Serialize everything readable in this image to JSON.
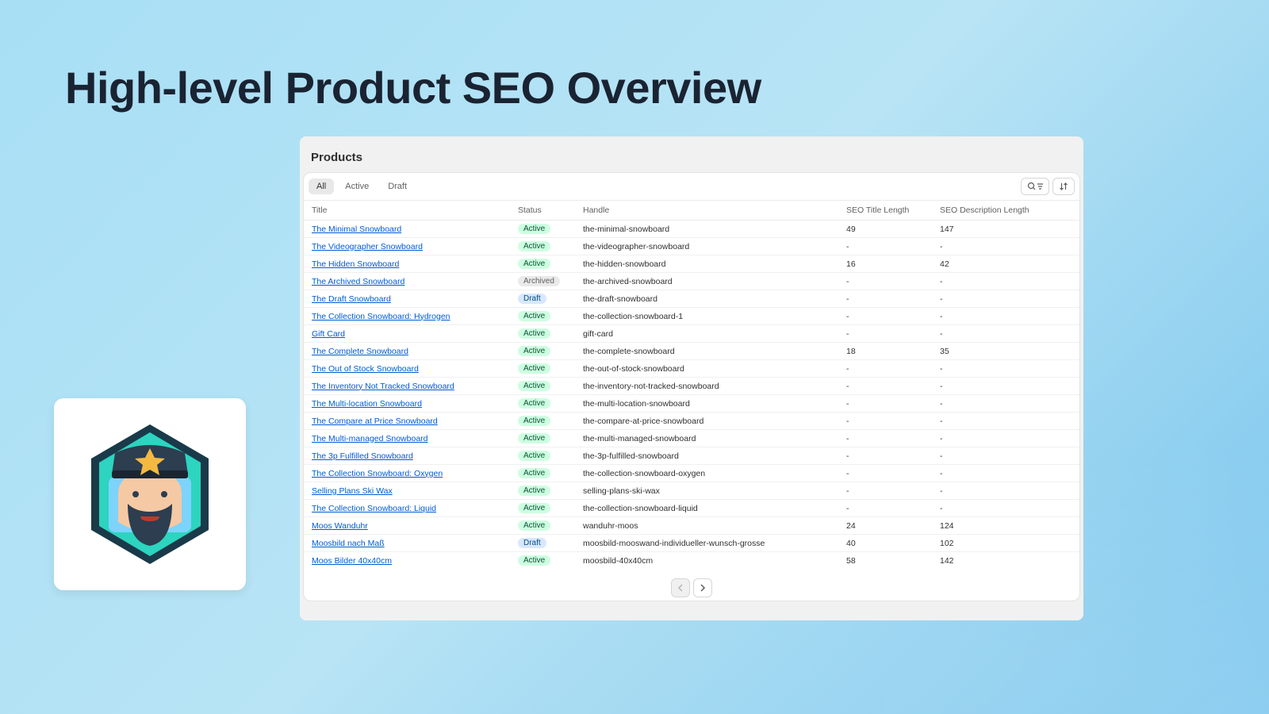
{
  "page": {
    "title": "High-level Product SEO Overview"
  },
  "panel": {
    "heading": "Products"
  },
  "tabs": {
    "all": "All",
    "active": "Active",
    "draft": "Draft"
  },
  "columns": {
    "title": "Title",
    "status": "Status",
    "handle": "Handle",
    "seo_title": "SEO Title Length",
    "seo_desc": "SEO Description Length"
  },
  "rows": [
    {
      "title": "The Minimal Snowboard",
      "status": "Active",
      "handle": "the-minimal-snowboard",
      "seo_title": "49",
      "seo_desc": "147"
    },
    {
      "title": "The Videographer Snowboard",
      "status": "Active",
      "handle": "the-videographer-snowboard",
      "seo_title": "-",
      "seo_desc": "-"
    },
    {
      "title": "The Hidden Snowboard",
      "status": "Active",
      "handle": "the-hidden-snowboard",
      "seo_title": "16",
      "seo_desc": "42"
    },
    {
      "title": "The Archived Snowboard",
      "status": "Archived",
      "handle": "the-archived-snowboard",
      "seo_title": "-",
      "seo_desc": "-"
    },
    {
      "title": "The Draft Snowboard",
      "status": "Draft",
      "handle": "the-draft-snowboard",
      "seo_title": "-",
      "seo_desc": "-"
    },
    {
      "title": "The Collection Snowboard: Hydrogen",
      "status": "Active",
      "handle": "the-collection-snowboard-1",
      "seo_title": "-",
      "seo_desc": "-"
    },
    {
      "title": "Gift Card",
      "status": "Active",
      "handle": "gift-card",
      "seo_title": "-",
      "seo_desc": "-"
    },
    {
      "title": "The Complete Snowboard",
      "status": "Active",
      "handle": "the-complete-snowboard",
      "seo_title": "18",
      "seo_desc": "35"
    },
    {
      "title": "The Out of Stock Snowboard",
      "status": "Active",
      "handle": "the-out-of-stock-snowboard",
      "seo_title": "-",
      "seo_desc": "-"
    },
    {
      "title": "The Inventory Not Tracked Snowboard",
      "status": "Active",
      "handle": "the-inventory-not-tracked-snowboard",
      "seo_title": "-",
      "seo_desc": "-"
    },
    {
      "title": "The Multi-location Snowboard",
      "status": "Active",
      "handle": "the-multi-location-snowboard",
      "seo_title": "-",
      "seo_desc": "-"
    },
    {
      "title": "The Compare at Price Snowboard",
      "status": "Active",
      "handle": "the-compare-at-price-snowboard",
      "seo_title": "-",
      "seo_desc": "-"
    },
    {
      "title": "The Multi-managed Snowboard",
      "status": "Active",
      "handle": "the-multi-managed-snowboard",
      "seo_title": "-",
      "seo_desc": "-"
    },
    {
      "title": "The 3p Fulfilled Snowboard",
      "status": "Active",
      "handle": "the-3p-fulfilled-snowboard",
      "seo_title": "-",
      "seo_desc": "-"
    },
    {
      "title": "The Collection Snowboard: Oxygen",
      "status": "Active",
      "handle": "the-collection-snowboard-oxygen",
      "seo_title": "-",
      "seo_desc": "-"
    },
    {
      "title": "Selling Plans Ski Wax",
      "status": "Active",
      "handle": "selling-plans-ski-wax",
      "seo_title": "-",
      "seo_desc": "-"
    },
    {
      "title": "The Collection Snowboard: Liquid",
      "status": "Active",
      "handle": "the-collection-snowboard-liquid",
      "seo_title": "-",
      "seo_desc": "-"
    },
    {
      "title": "Moos Wanduhr",
      "status": "Active",
      "handle": "wanduhr-moos",
      "seo_title": "24",
      "seo_desc": "124"
    },
    {
      "title": "Moosbild nach Maß",
      "status": "Draft",
      "handle": "moosbild-mooswand-individueller-wunsch-grosse",
      "seo_title": "40",
      "seo_desc": "102"
    },
    {
      "title": "Moos Bilder 40x40cm",
      "status": "Active",
      "handle": "moosbild-40x40cm",
      "seo_title": "58",
      "seo_desc": "142"
    }
  ]
}
